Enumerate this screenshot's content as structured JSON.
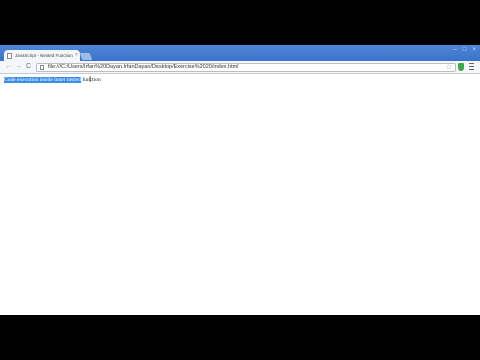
{
  "browser": {
    "tab": {
      "title": "JavaScript - Nested Function",
      "close_icon": "close-icon"
    },
    "window_controls": [
      "–",
      "□",
      "×"
    ],
    "toolbar": {
      "back_icon": "←",
      "forward_icon": "→",
      "reload_icon": "C",
      "url": "file:///C:/Users/Irfan%20Dayan.IrfanDayan/Desktop/Exercise%2020/index.html",
      "star_icon": "☆"
    }
  },
  "page": {
    "selected_text": "Code execution inside inner nested",
    "rest_text": "function",
    "cursor_icon": "I"
  }
}
